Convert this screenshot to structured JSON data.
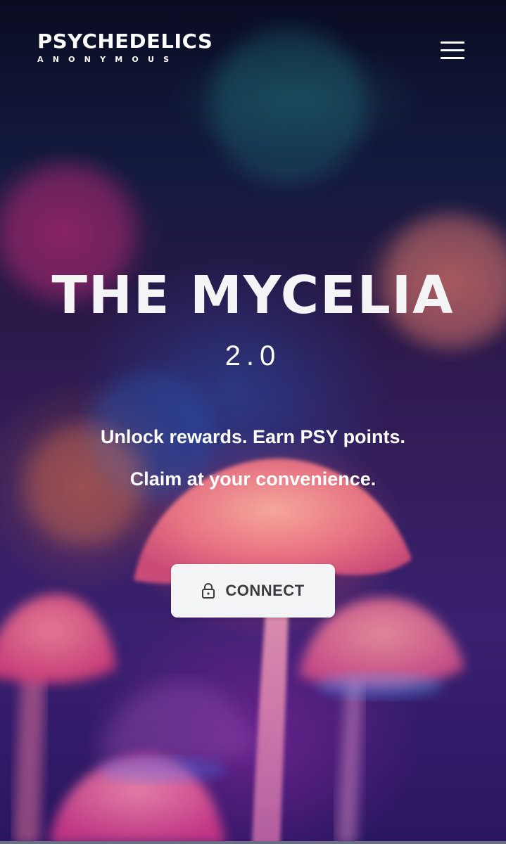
{
  "header": {
    "logo_main": "PSYCHEDELICS",
    "logo_sub": "ANONYMOUS",
    "menu_icon": "hamburger-menu-icon"
  },
  "hero": {
    "title": "THE MYCELIA",
    "version": "2.0",
    "tagline_line1": "Unlock rewards. Earn PSY points.",
    "tagline_line2": "Claim at your convenience."
  },
  "connect": {
    "label": "CONNECT",
    "icon": "lock-icon"
  },
  "colors": {
    "button_bg": "#f3f4f6",
    "button_text": "#3b3b3f",
    "text": "#ffffff"
  }
}
